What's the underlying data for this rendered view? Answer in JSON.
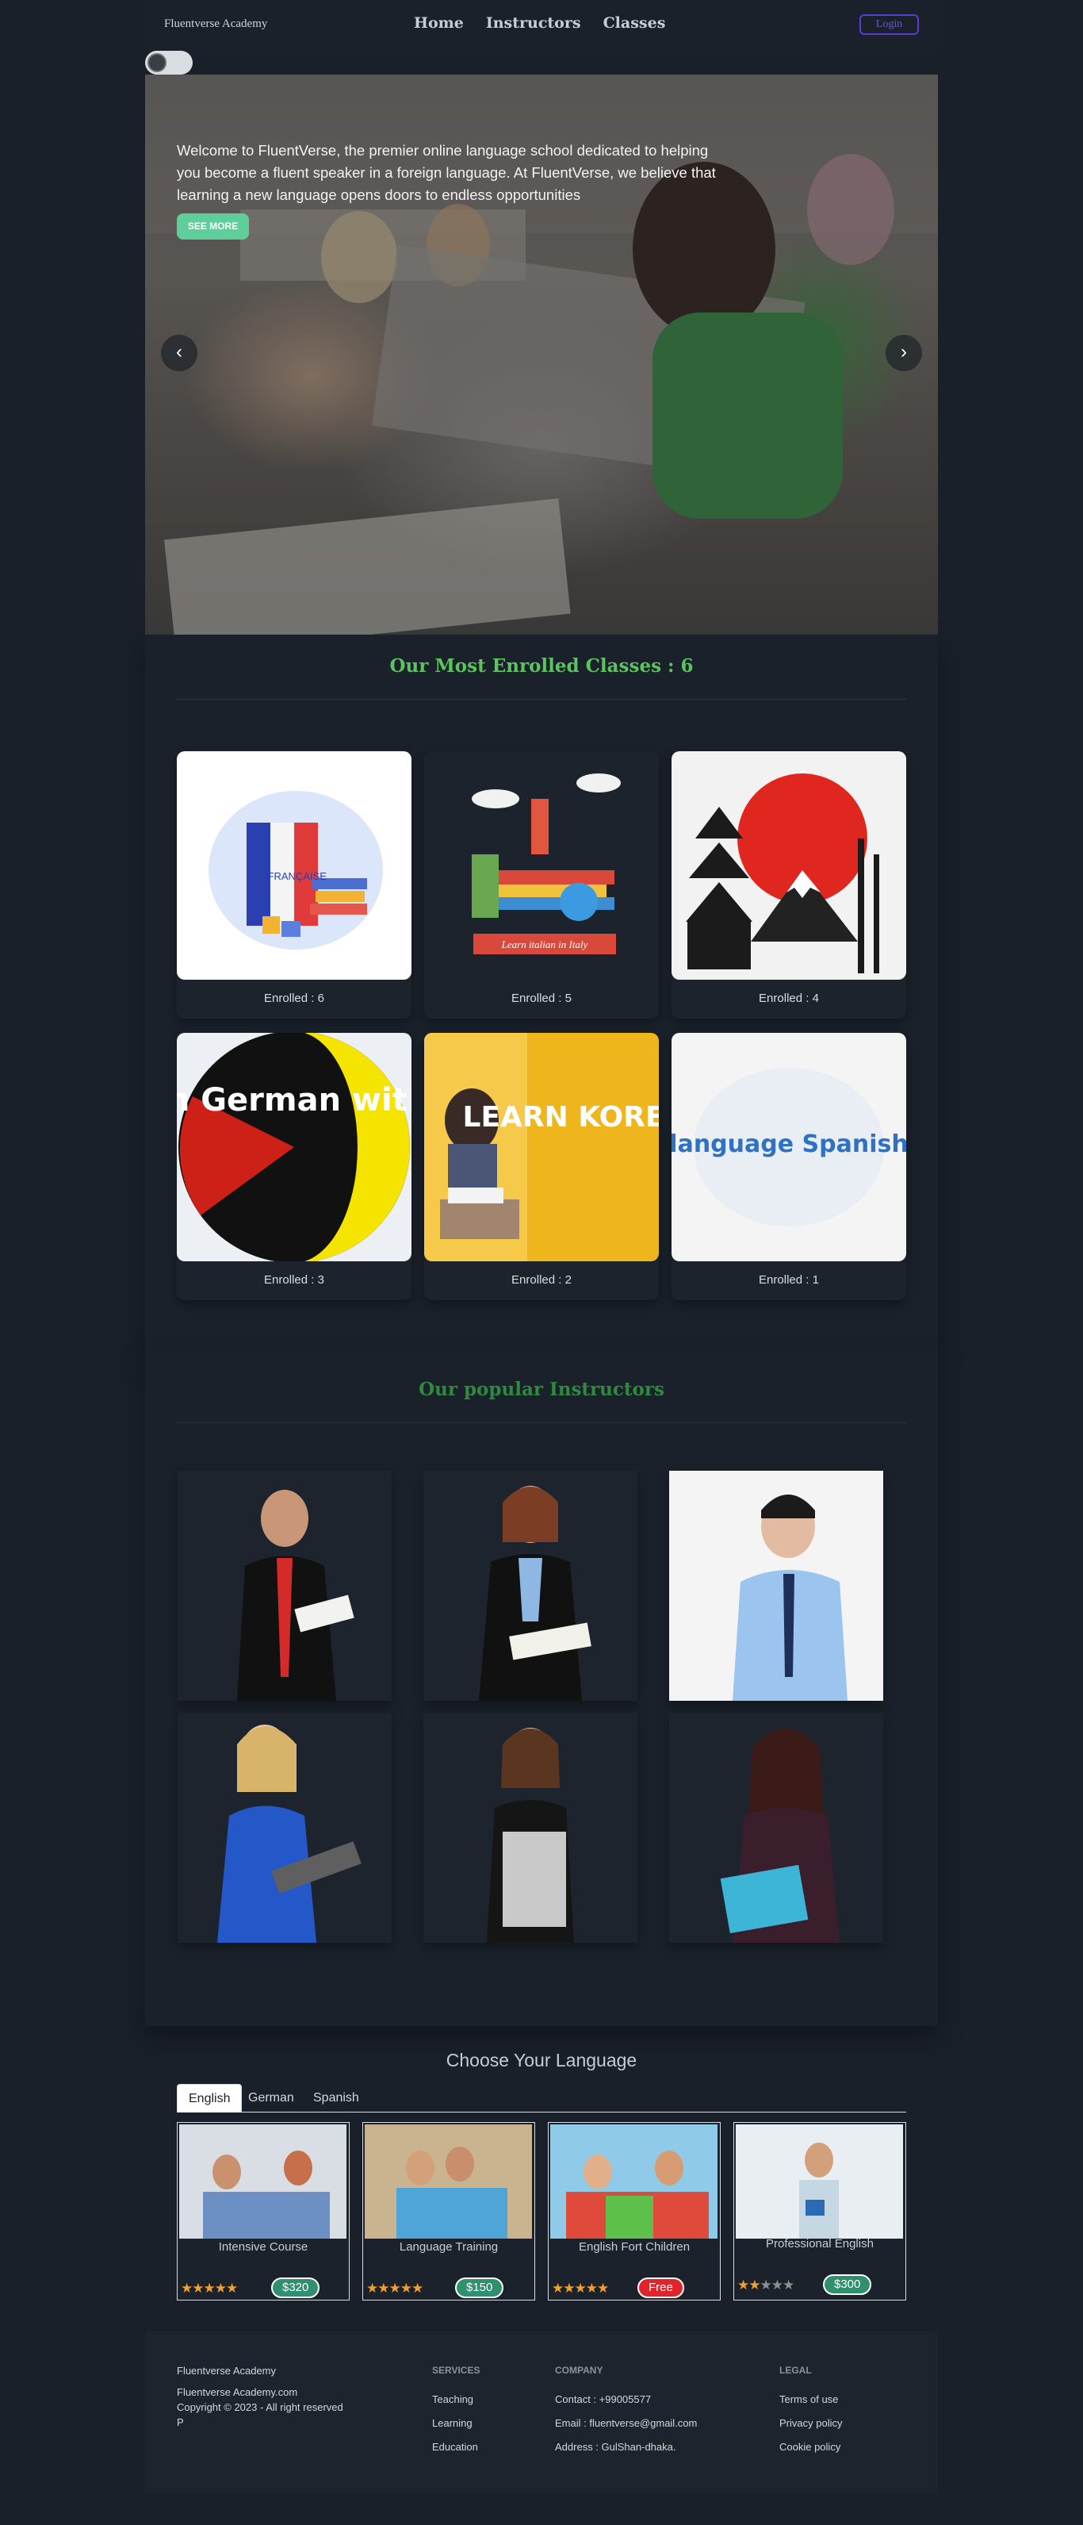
{
  "nav": {
    "brand": "Fluentverse Academy",
    "links": [
      "Home",
      "Instructors",
      "Classes"
    ],
    "login": "Login"
  },
  "hero": {
    "text": "Welcome to FluentVerse, the premier online language school dedicated to helping you become a fluent speaker in a foreign language. At FluentVerse, we believe that learning a new language opens doors to endless opportunities",
    "button": "SEE MORE",
    "prev": "‹",
    "next": "›"
  },
  "classes": {
    "title": "Our Most Enrolled Classes : 6",
    "items": [
      {
        "enrolled": "Enrolled : 6",
        "image_text": "LE FRANÇAISE"
      },
      {
        "enrolled": "Enrolled : 5",
        "image_text": "Learn italian in Italy"
      },
      {
        "enrolled": "Enrolled : 4",
        "image_text": ""
      },
      {
        "enrolled": "Enrolled : 3",
        "image_text": "Learn German with fun"
      },
      {
        "enrolled": "Enrolled : 2",
        "image_text": "LEARN KOREAN"
      },
      {
        "enrolled": "Enrolled : 1",
        "image_text": "language Spanish"
      }
    ]
  },
  "instructors": {
    "title": "Our popular Instructors"
  },
  "language": {
    "title": "Choose Your Language",
    "tabs": [
      "English",
      "German",
      "Spanish"
    ],
    "courses": [
      {
        "name": "Intensive Course",
        "price": "$320",
        "rating": 5,
        "price_color": "#2f8f6e"
      },
      {
        "name": "Language Training",
        "price": "$150",
        "rating": 5,
        "price_color": "#2f8f6e"
      },
      {
        "name": "English Fort Children",
        "price": "Free",
        "rating": 5,
        "price_color": "#e0242c"
      },
      {
        "name": "Professional English",
        "price": "$300",
        "rating": 2,
        "price_color": "#2f8f6e"
      }
    ]
  },
  "footer": {
    "brand": "Fluentverse Academy",
    "site": "Fluentverse Academy.com",
    "copyright": "Copyright © 2023 - All right reserved",
    "p": "P",
    "services": {
      "heading": "SERVICES",
      "items": [
        "Teaching",
        "Learning",
        "Education"
      ]
    },
    "company": {
      "heading": "COMPANY",
      "items": [
        "Contact : +99005577",
        "Email : fluentverse@gmail.com",
        "Address : GulShan-dhaka."
      ]
    },
    "legal": {
      "heading": "LEGAL",
      "items": [
        "Terms of use",
        "Privacy policy",
        "Cookie policy"
      ]
    }
  }
}
